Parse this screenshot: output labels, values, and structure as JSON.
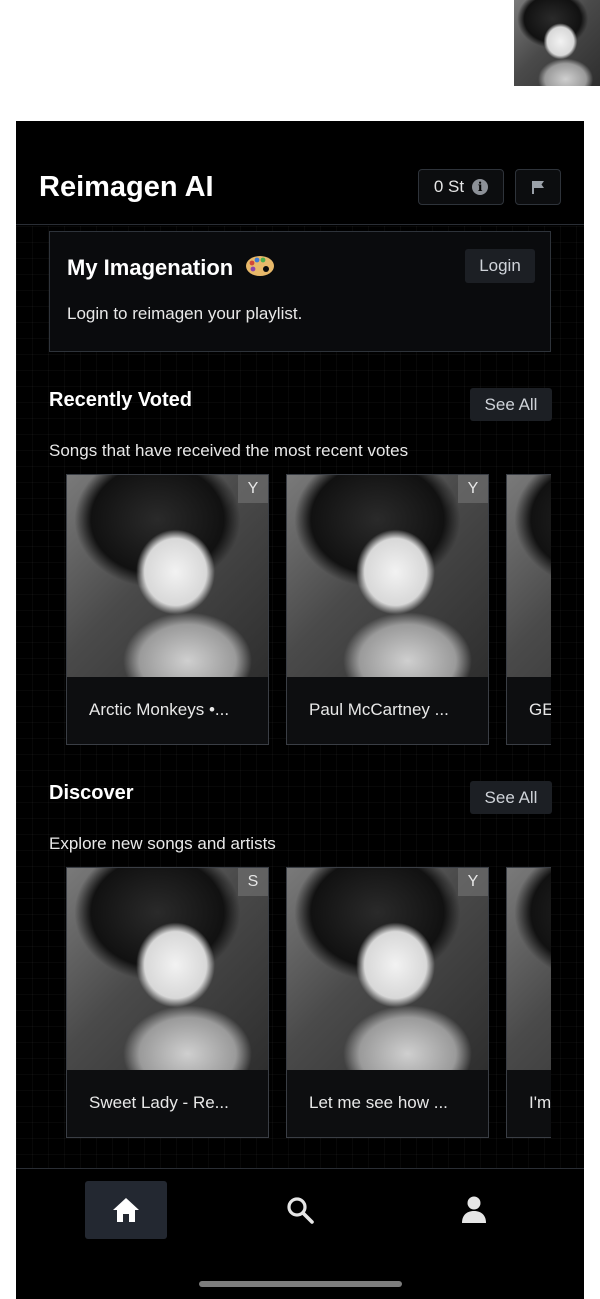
{
  "header": {
    "app_title": "Reimagen AI",
    "credits_label": "0 St",
    "info_icon": "info-icon",
    "flag_icon": "flag-icon"
  },
  "my_imagenation": {
    "title": "My Imagenation",
    "icon": "palette-icon",
    "login_label": "Login",
    "description": "Login to reimagen your playlist."
  },
  "recently_voted": {
    "title": "Recently Voted",
    "see_all_label": "See All",
    "subtitle": "Songs that have received the most recent votes",
    "cards": [
      {
        "label": "Arctic Monkeys •...",
        "badge": "Y"
      },
      {
        "label": "Paul McCartney ...",
        "badge": "Y"
      },
      {
        "label": "GE",
        "badge": ""
      }
    ]
  },
  "discover": {
    "title": "Discover",
    "see_all_label": "See All",
    "subtitle": "Explore new songs and artists",
    "cards": [
      {
        "label": "Sweet Lady - Re...",
        "badge": "S"
      },
      {
        "label": "Let me see how ...",
        "badge": "Y"
      },
      {
        "label": "I'm",
        "badge": ""
      }
    ]
  },
  "bottom_nav": {
    "items": [
      {
        "icon": "home-icon",
        "active": true
      },
      {
        "icon": "search-icon",
        "active": false
      },
      {
        "icon": "profile-icon",
        "active": false
      }
    ]
  },
  "colors": {
    "background": "#000000",
    "surface": "#1c1f24",
    "border": "#2e333a",
    "nav_active": "#232831",
    "text": "#ffffff"
  }
}
